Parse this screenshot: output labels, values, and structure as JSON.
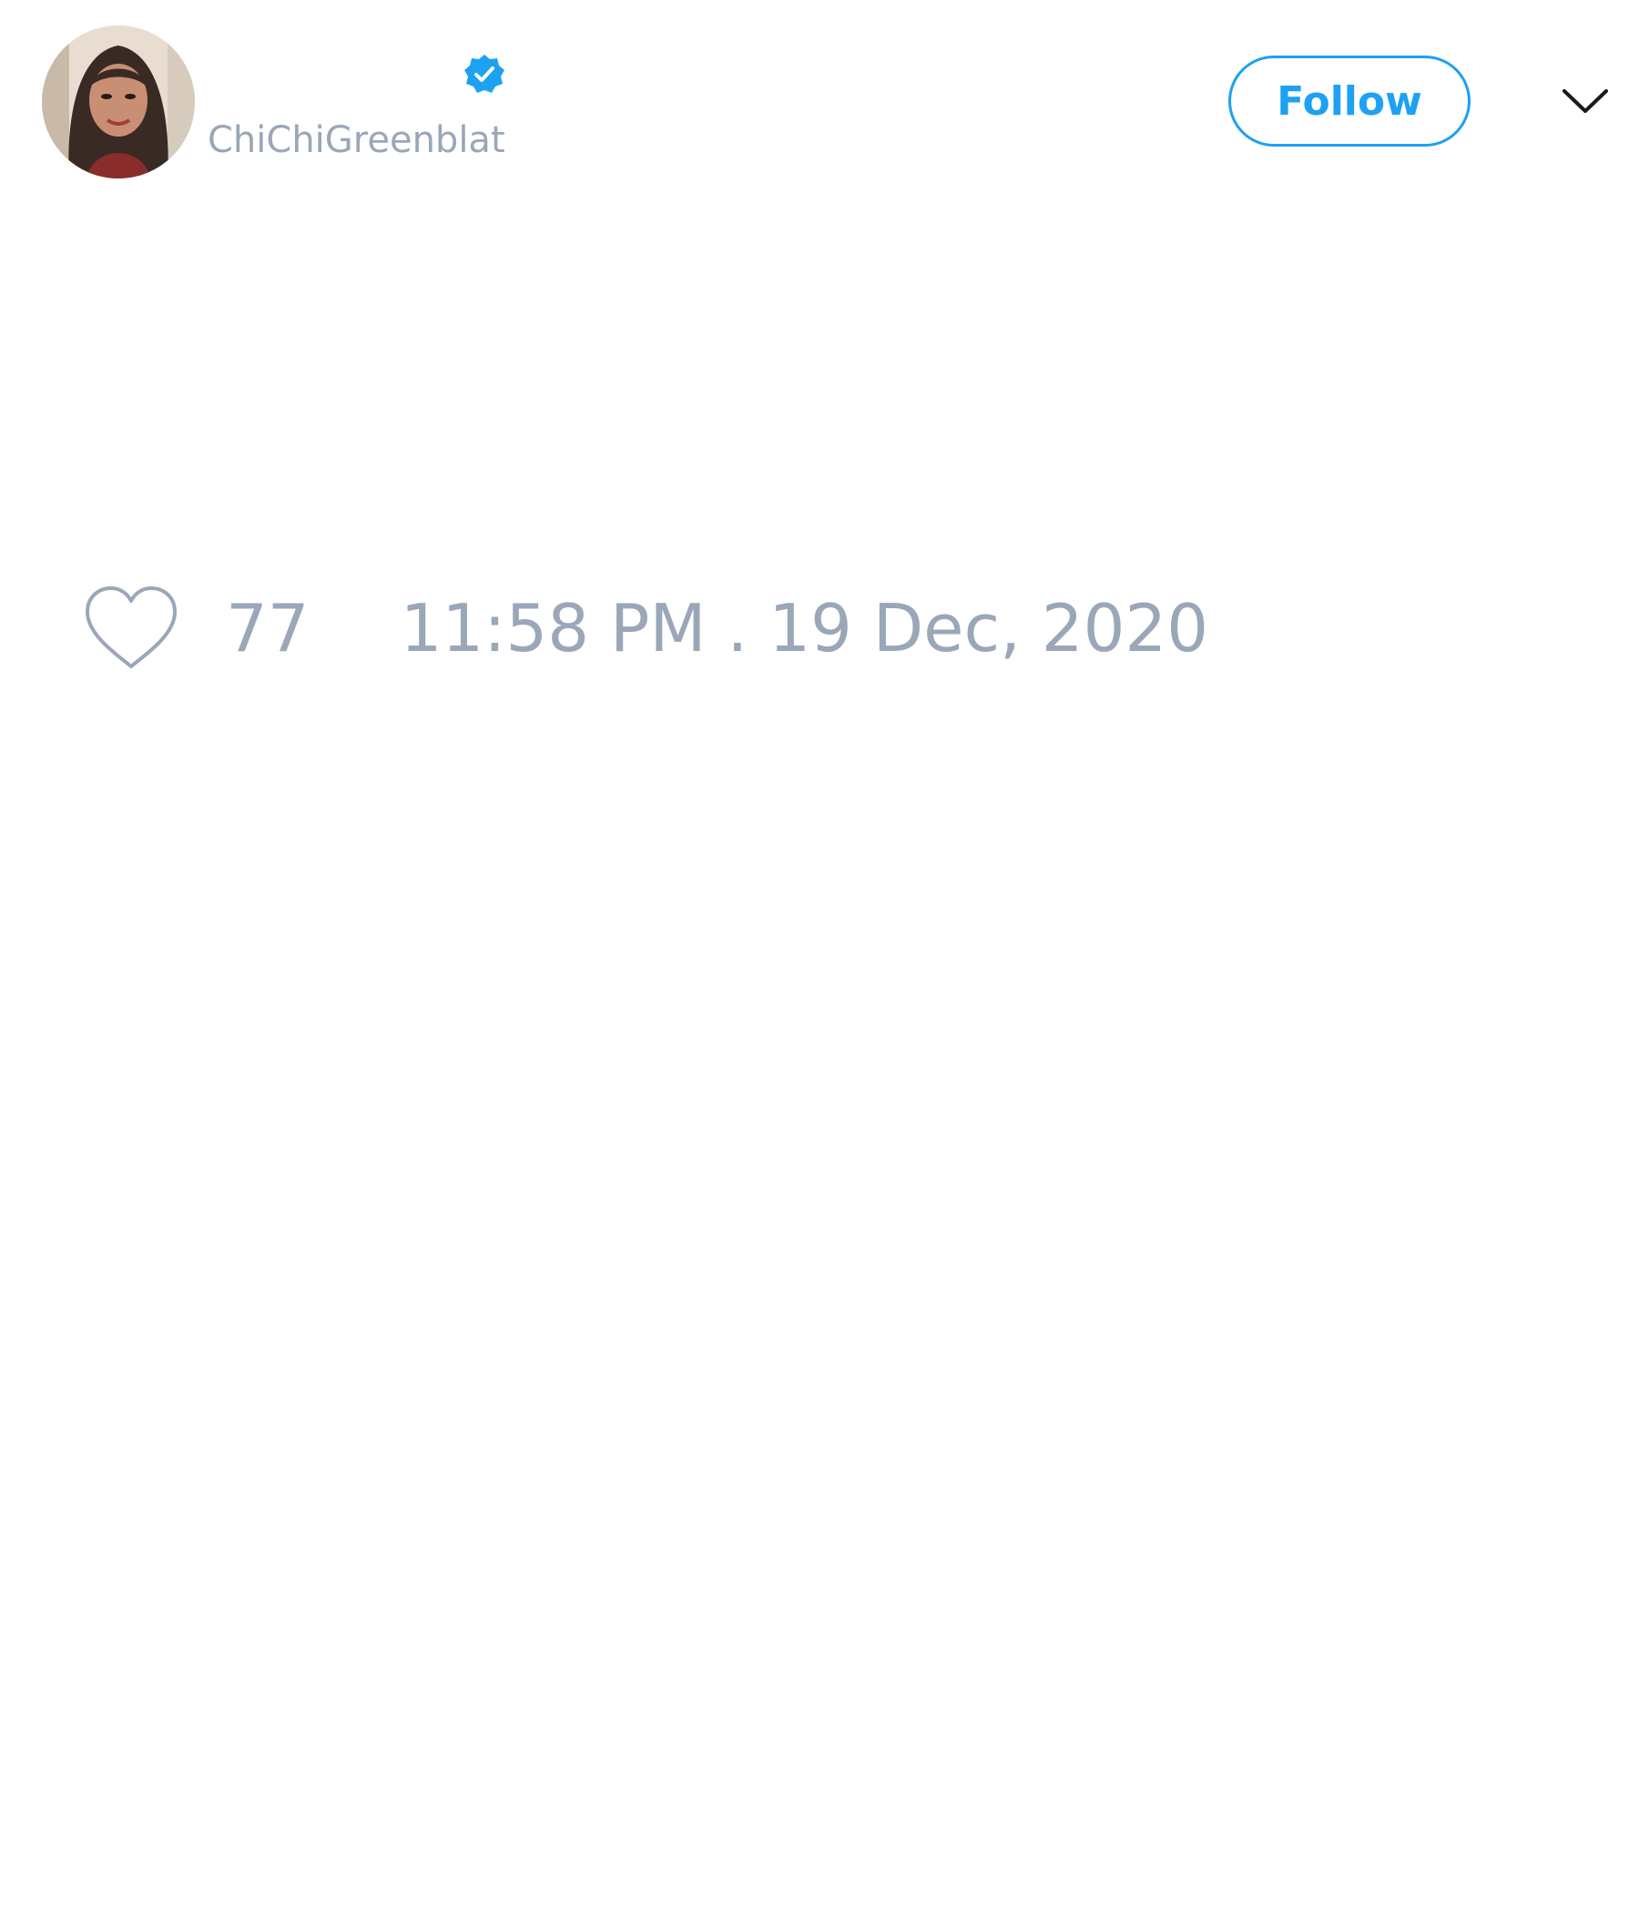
{
  "tweet": {
    "author": {
      "display_name": "",
      "username": "ChiChiGreenblat",
      "verified": true,
      "avatar_icon": "profile-photo-woman"
    },
    "follow_label": "Follow",
    "menu_icon": "chevron-down-icon",
    "like_icon": "heart-outline-icon",
    "like_count": "77",
    "timestamp": "11:58 PM . 19 Dec, 2020"
  },
  "colors": {
    "accent": "#1da1f2",
    "muted_text": "#9aa7b8",
    "background": "#ffffff"
  }
}
